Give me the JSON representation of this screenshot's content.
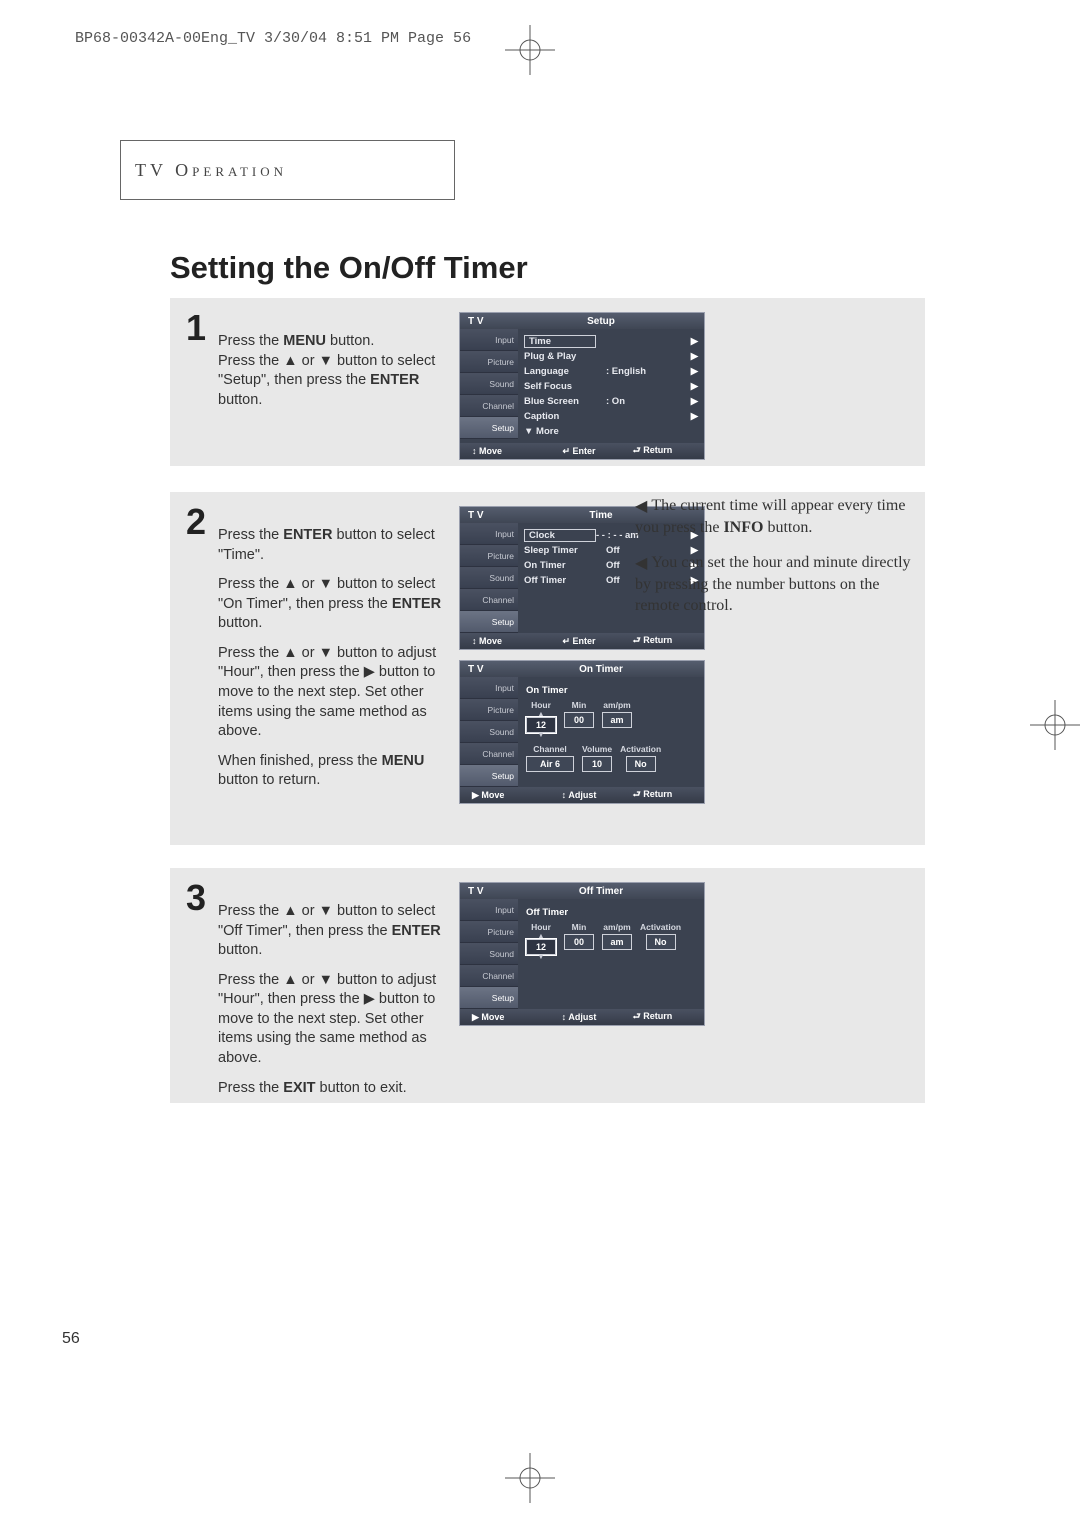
{
  "header_line": "BP68-00342A-00Eng_TV  3/30/04  8:51 PM  Page 56",
  "section_title": "TV Operation",
  "main_heading": "Setting the On/Off Timer",
  "page_number": "56",
  "step1": {
    "num": "1",
    "l1a": "Press the ",
    "l1b": "MENU",
    "l1c": " button.",
    "l2a": "Press the ▲ or ▼ button to select \"Setup\", then press the ",
    "l2b": "ENTER",
    "l2c": " button."
  },
  "step2": {
    "num": "2",
    "p1a": "Press the ",
    "p1b": "ENTER",
    "p1c": " button to select \"Time\".",
    "p2a": "Press the ▲ or ▼ button to select \"On Timer\", then press the ",
    "p2b": "ENTER",
    "p2c": " button.",
    "p3": "Press the ▲ or ▼ button to adjust \"Hour\", then press the ▶ button to move to the next step. Set other items using the same method as above.",
    "p4a": "When finished, press the ",
    "p4b": "MENU",
    "p4c": " button to return."
  },
  "step3": {
    "num": "3",
    "p1a": "Press the ▲ or ▼ button to select \"Off Timer\", then press the ",
    "p1b": "ENTER",
    "p1c": " button.",
    "p2": "Press the ▲ or ▼ button to adjust \"Hour\", then press the ▶ button to move to the next step. Set other items using the same method as above.",
    "p3a": "Press the ",
    "p3b": "EXIT",
    "p3c": " button to exit."
  },
  "notes": {
    "n1": "The current time will appear every time you press the ",
    "n1b": "INFO",
    "n1c": " button.",
    "n2": "You can set the hour and minute directly by pressing the number buttons on the remote control."
  },
  "osd_common": {
    "tv": "T V",
    "tabs": [
      "Input",
      "Picture",
      "Sound",
      "Channel",
      "Setup"
    ],
    "foot_move": "Move",
    "foot_enter": "Enter",
    "foot_return": "Return",
    "foot_adjust": "Adjust"
  },
  "osd_setup": {
    "title": "Setup",
    "active_tab": 4,
    "rows": [
      {
        "label": "Time",
        "val": "",
        "hl": true,
        "arr": "▶"
      },
      {
        "label": "Plug & Play",
        "val": "",
        "arr": "▶"
      },
      {
        "label": "Language",
        "val": ":   English",
        "arr": "▶"
      },
      {
        "label": "Self Focus",
        "val": "",
        "arr": "▶"
      },
      {
        "label": "Blue Screen",
        "val": ":   On",
        "arr": "▶"
      },
      {
        "label": "Caption",
        "val": "",
        "arr": "▶"
      },
      {
        "label": "▼ More",
        "val": "",
        "arr": ""
      }
    ],
    "foot": [
      "↕ Move",
      "↵ Enter",
      "⮐ Return"
    ]
  },
  "osd_time": {
    "title": "Time",
    "active_tab": 4,
    "rows": [
      {
        "label": "Clock",
        "val": "- - : - -  am",
        "hl": true,
        "arr": "▶"
      },
      {
        "label": "Sleep Timer",
        "val": "Off",
        "arr": "▶"
      },
      {
        "label": "On Timer",
        "val": "Off",
        "arr": "▶"
      },
      {
        "label": "Off Timer",
        "val": "Off",
        "arr": "▶"
      }
    ],
    "foot": [
      "↕ Move",
      "↵ Enter",
      "⮐ Return"
    ]
  },
  "osd_on_timer": {
    "title": "On Timer",
    "active_tab": 4,
    "sub1": "On Timer",
    "row1_heads": [
      "Hour",
      "Min",
      "am/pm"
    ],
    "row1_vals": [
      "12",
      "00",
      "am"
    ],
    "row2_heads": [
      "Channel",
      "Volume",
      "Activation"
    ],
    "row2_vals": [
      "Air   6",
      "10",
      "No"
    ],
    "foot": [
      "▶ Move",
      "↕ Adjust",
      "⮐ Return"
    ]
  },
  "osd_off_timer": {
    "title": "Off Timer",
    "active_tab": 4,
    "sub1": "Off Timer",
    "row1_heads": [
      "Hour",
      "Min",
      "am/pm",
      "Activation"
    ],
    "row1_vals": [
      "12",
      "00",
      "am",
      "No"
    ],
    "foot": [
      "▶ Move",
      "↕ Adjust",
      "⮐ Return"
    ]
  }
}
